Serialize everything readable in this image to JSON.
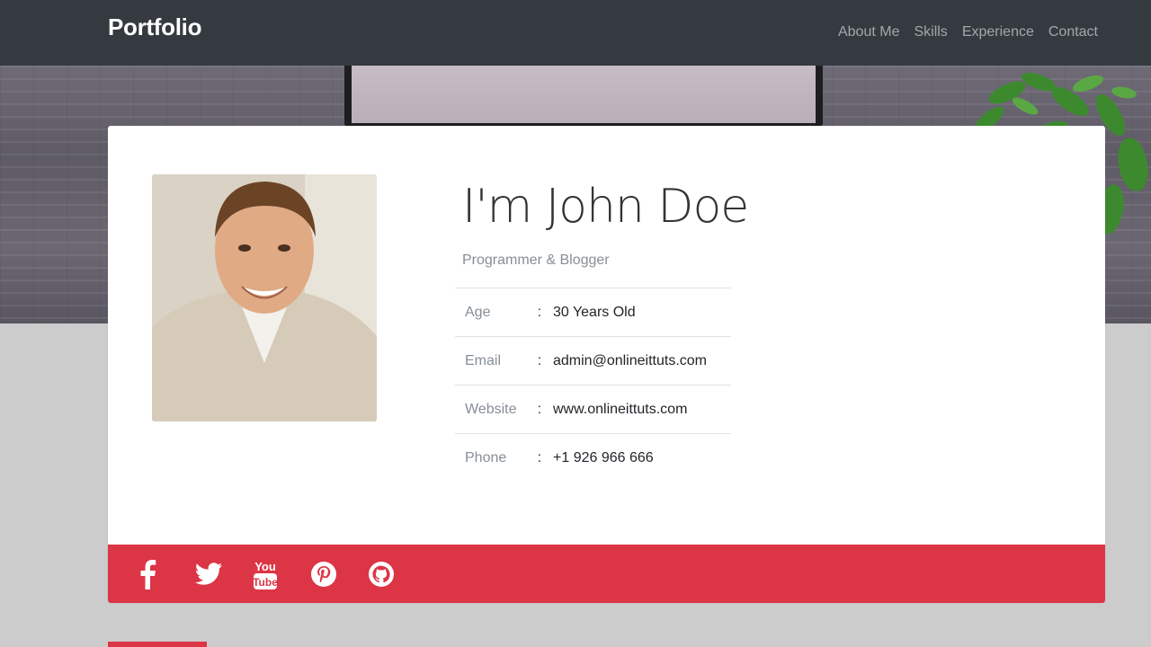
{
  "navbar": {
    "brand": "Portfolio",
    "links": [
      "About Me",
      "Skills",
      "Experience",
      "Contact"
    ]
  },
  "profile": {
    "name": "I'm John Doe",
    "role": "Programmer & Blogger",
    "photo_icon": "profile-photo",
    "details": [
      {
        "label": "Age",
        "separator": ":",
        "value": "30 Years Old"
      },
      {
        "label": "Email",
        "separator": ":",
        "value": "admin@onlineittuts.com"
      },
      {
        "label": "Website",
        "separator": ":",
        "value": "www.onlineittuts.com"
      },
      {
        "label": "Phone",
        "separator": ":",
        "value": "+1 926 966 666"
      }
    ]
  },
  "social": {
    "icons": [
      "facebook-icon",
      "twitter-icon",
      "youtube-icon",
      "pinterest-icon",
      "github-icon"
    ]
  },
  "colors": {
    "navbar_bg": "#343a40",
    "accent": "#dc3545",
    "page_bg": "#cccccc",
    "card_bg": "#ffffff",
    "muted_text": "#868e96"
  }
}
